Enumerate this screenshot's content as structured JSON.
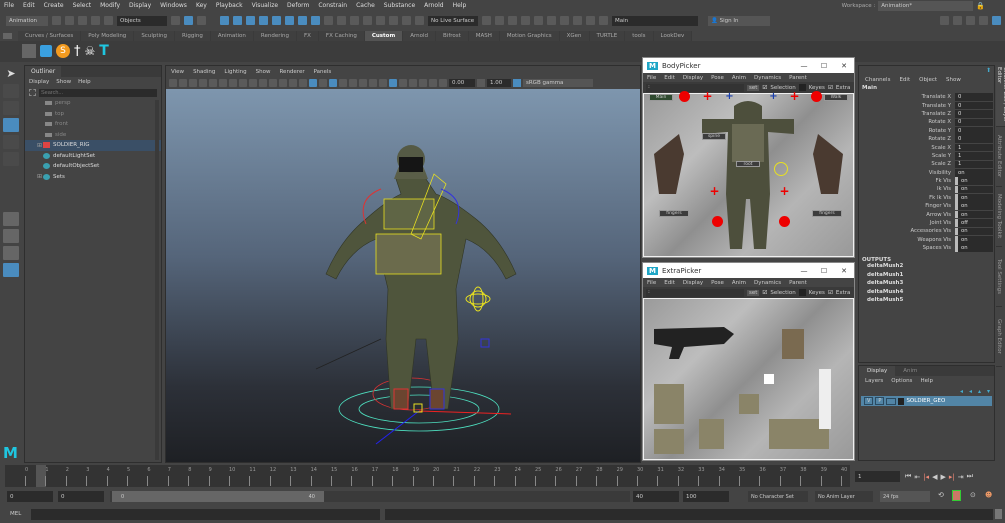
{
  "menubar": [
    "File",
    "Edit",
    "Create",
    "Select",
    "Modify",
    "Display",
    "Windows",
    "Key",
    "Playback",
    "Visualize",
    "Deform",
    "Constrain",
    "Cache",
    "Substance",
    "Arnold",
    "Help"
  ],
  "workspace": {
    "label": "Workspace :",
    "value": "Animation*"
  },
  "toolbar": {
    "mode": "Animation",
    "objects": "Objects",
    "live_surface": "No Live Surface",
    "panel_name": "Main",
    "sign_in": "Sign In"
  },
  "shelf_tabs": [
    "Curves / Surfaces",
    "Poly Modeling",
    "Sculpting",
    "Rigging",
    "Animation",
    "Rendering",
    "FX",
    "FX Caching",
    "Custom",
    "Arnold",
    "Bifrost",
    "MASH",
    "Motion Graphics",
    "XGen",
    "TURTLE",
    "tools",
    "LookDev"
  ],
  "shelf_active": "Custom",
  "outliner": {
    "title": "Outliner",
    "menu": [
      "Display",
      "Show",
      "Help"
    ],
    "search_placeholder": "Search...",
    "items": [
      {
        "label": "persp",
        "type": "camera"
      },
      {
        "label": "top",
        "type": "camera"
      },
      {
        "label": "front",
        "type": "camera"
      },
      {
        "label": "side",
        "type": "camera"
      },
      {
        "label": "SOLDIER_RIG",
        "type": "rig",
        "selected": true,
        "expandable": true
      },
      {
        "label": "defaultLightSet",
        "type": "set"
      },
      {
        "label": "defaultObjectSet",
        "type": "set"
      },
      {
        "label": "Sets",
        "type": "set",
        "expandable": true
      }
    ]
  },
  "viewport": {
    "menu": [
      "View",
      "Shading",
      "Lighting",
      "Show",
      "Renderer",
      "Panels"
    ],
    "exposure": "0.00",
    "gamma": "1.00",
    "color_space": "sRGB gamma"
  },
  "body_picker": {
    "title": "BodyPicker",
    "menu": [
      "File",
      "Edit",
      "Display",
      "Pose",
      "Anim",
      "Dynamics",
      "Parent"
    ],
    "namespace": ":",
    "set": "set",
    "selection": "Selection",
    "keyes": "Keyes",
    "extra": "Extra",
    "buttons": {
      "main": "Main",
      "walk": "Walk",
      "spine": "spine",
      "root": "root",
      "fingers_l": "fingers",
      "fingers_r": "fingers"
    }
  },
  "extra_picker": {
    "title": "ExtraPicker",
    "menu": [
      "File",
      "Edit",
      "Display",
      "Pose",
      "Anim",
      "Dynamics",
      "Parent"
    ],
    "namespace": ":",
    "set": "set",
    "selection": "Selection",
    "keyes": "Keyes",
    "extra": "Extra"
  },
  "channel_box": {
    "menu": [
      "Channels",
      "Edit",
      "Object",
      "Show"
    ],
    "object": "Main",
    "channels": [
      {
        "name": "Translate X",
        "value": "0"
      },
      {
        "name": "Translate Y",
        "value": "0"
      },
      {
        "name": "Translate Z",
        "value": "0"
      },
      {
        "name": "Rotate X",
        "value": "0"
      },
      {
        "name": "Rotate Y",
        "value": "0"
      },
      {
        "name": "Rotate Z",
        "value": "0"
      },
      {
        "name": "Scale X",
        "value": "1"
      },
      {
        "name": "Scale Y",
        "value": "1"
      },
      {
        "name": "Scale Z",
        "value": "1"
      },
      {
        "name": "Visibility",
        "value": "on"
      },
      {
        "name": "Fk Vis",
        "value": "on"
      },
      {
        "name": "Ik Vis",
        "value": "on"
      },
      {
        "name": "Fk Ik Vis",
        "value": "on"
      },
      {
        "name": "Finger Vis",
        "value": "on"
      },
      {
        "name": "Arrow Vis",
        "value": "on"
      },
      {
        "name": "Joint Vis",
        "value": "off"
      },
      {
        "name": "Accessories Vis",
        "value": "on"
      },
      {
        "name": "Weapons Vis",
        "value": "on"
      },
      {
        "name": "Spaces Vis",
        "value": "on"
      }
    ],
    "outputs_label": "OUTPUTS",
    "outputs": [
      "deltaMush2",
      "deltaMush1",
      "deltaMush3",
      "deltaMush4",
      "deltaMush5"
    ]
  },
  "layer_editor": {
    "tabs": [
      "Display",
      "Anim"
    ],
    "menu": [
      "Layers",
      "Options",
      "Help"
    ],
    "layer": {
      "v": "V",
      "p": "P",
      "name": "SOLDIER_GEO"
    }
  },
  "side_tabs": [
    "Channel Box / Layer Editor",
    "Attribute Editor",
    "Modeling Toolkit",
    "Tool Settings",
    "Graph Editor"
  ],
  "timeline": {
    "ticks": [
      "0",
      "1",
      "2",
      "3",
      "4",
      "5",
      "6",
      "7",
      "8",
      "9",
      "10",
      "11",
      "12",
      "13",
      "14",
      "15",
      "16",
      "17",
      "18",
      "19",
      "20",
      "21",
      "22",
      "23",
      "24",
      "25",
      "26",
      "27",
      "28",
      "29",
      "30",
      "31",
      "32",
      "33",
      "34",
      "35",
      "36",
      "37",
      "38",
      "39",
      "40"
    ],
    "current_frame": "1"
  },
  "range": {
    "start": "0",
    "playback_start": "0",
    "slider_start": "0",
    "slider_end": "40",
    "playback_end": "40",
    "end": "100",
    "character_set": "No Character Set",
    "anim_layer": "No Anim Layer",
    "fps": "24 fps"
  },
  "command_line": {
    "label": "MEL"
  },
  "colors": {
    "accent": "#4a8cbf",
    "selection": "#5285a6",
    "viewport_top": "#7e96ae",
    "viewport_bottom": "#1e2024"
  }
}
